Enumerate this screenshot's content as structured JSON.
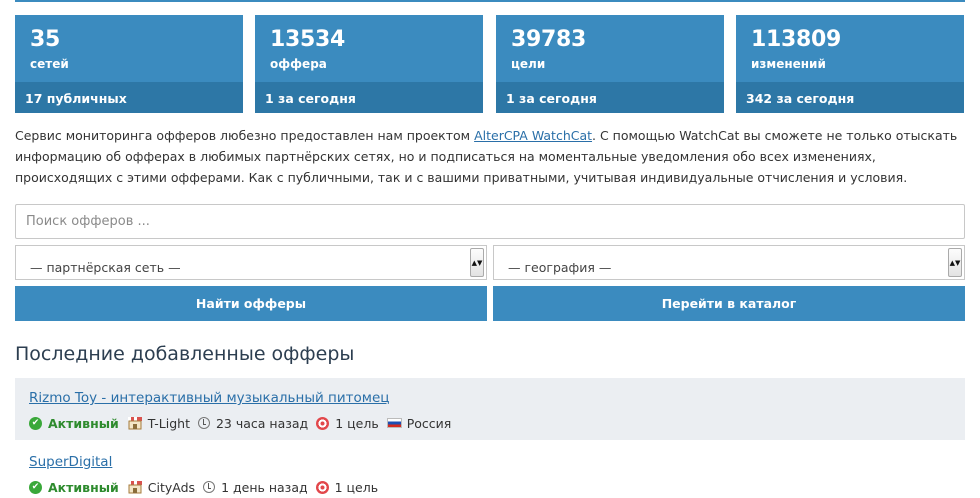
{
  "stats": [
    {
      "value": "35",
      "label": "сетей",
      "footer": "17 публичных"
    },
    {
      "value": "13534",
      "label": "оффера",
      "footer": "1 за сегодня"
    },
    {
      "value": "39783",
      "label": "цели",
      "footer": "1 за сегодня"
    },
    {
      "value": "113809",
      "label": "изменений",
      "footer": "342 за сегодня"
    }
  ],
  "description": {
    "before": "Сервис мониторинга офферов любезно предоставлен нам проектом ",
    "link": "AlterCPA WatchCat",
    "after": ". С помощью WatchCat вы сможете не только отыскать информацию об офферах в любимых партнёрских сетях, но и подписаться на моментальные уведомления обо всех изменениях, происходящих с этими офферами. Как с публичными, так и с вашими приватными, учитывая индивидуальные отчисления и условия."
  },
  "search": {
    "placeholder": "Поиск офферов ..."
  },
  "filters": {
    "network": "— партнёрская сеть —",
    "geo": "— география —"
  },
  "buttons": {
    "find": "Найти офферы",
    "catalog": "Перейти в каталог"
  },
  "section_title": "Последние добавленные офферы",
  "offers": [
    {
      "title": "Rizmo Toy - интерактивный музыкальный питомец",
      "status": "Активный",
      "network": "T-Light",
      "time": "23 часа назад",
      "goals": "1 цель",
      "geo": "Россия"
    },
    {
      "title": "SuperDigital",
      "status": "Активный",
      "network": "CityAds",
      "time": "1 день назад",
      "goals": "1 цель"
    }
  ],
  "colors": {
    "accent": "#3b8bbf",
    "accent_dark": "#2d77a6",
    "link": "#2a6fa8",
    "active": "#2e8b2e"
  }
}
